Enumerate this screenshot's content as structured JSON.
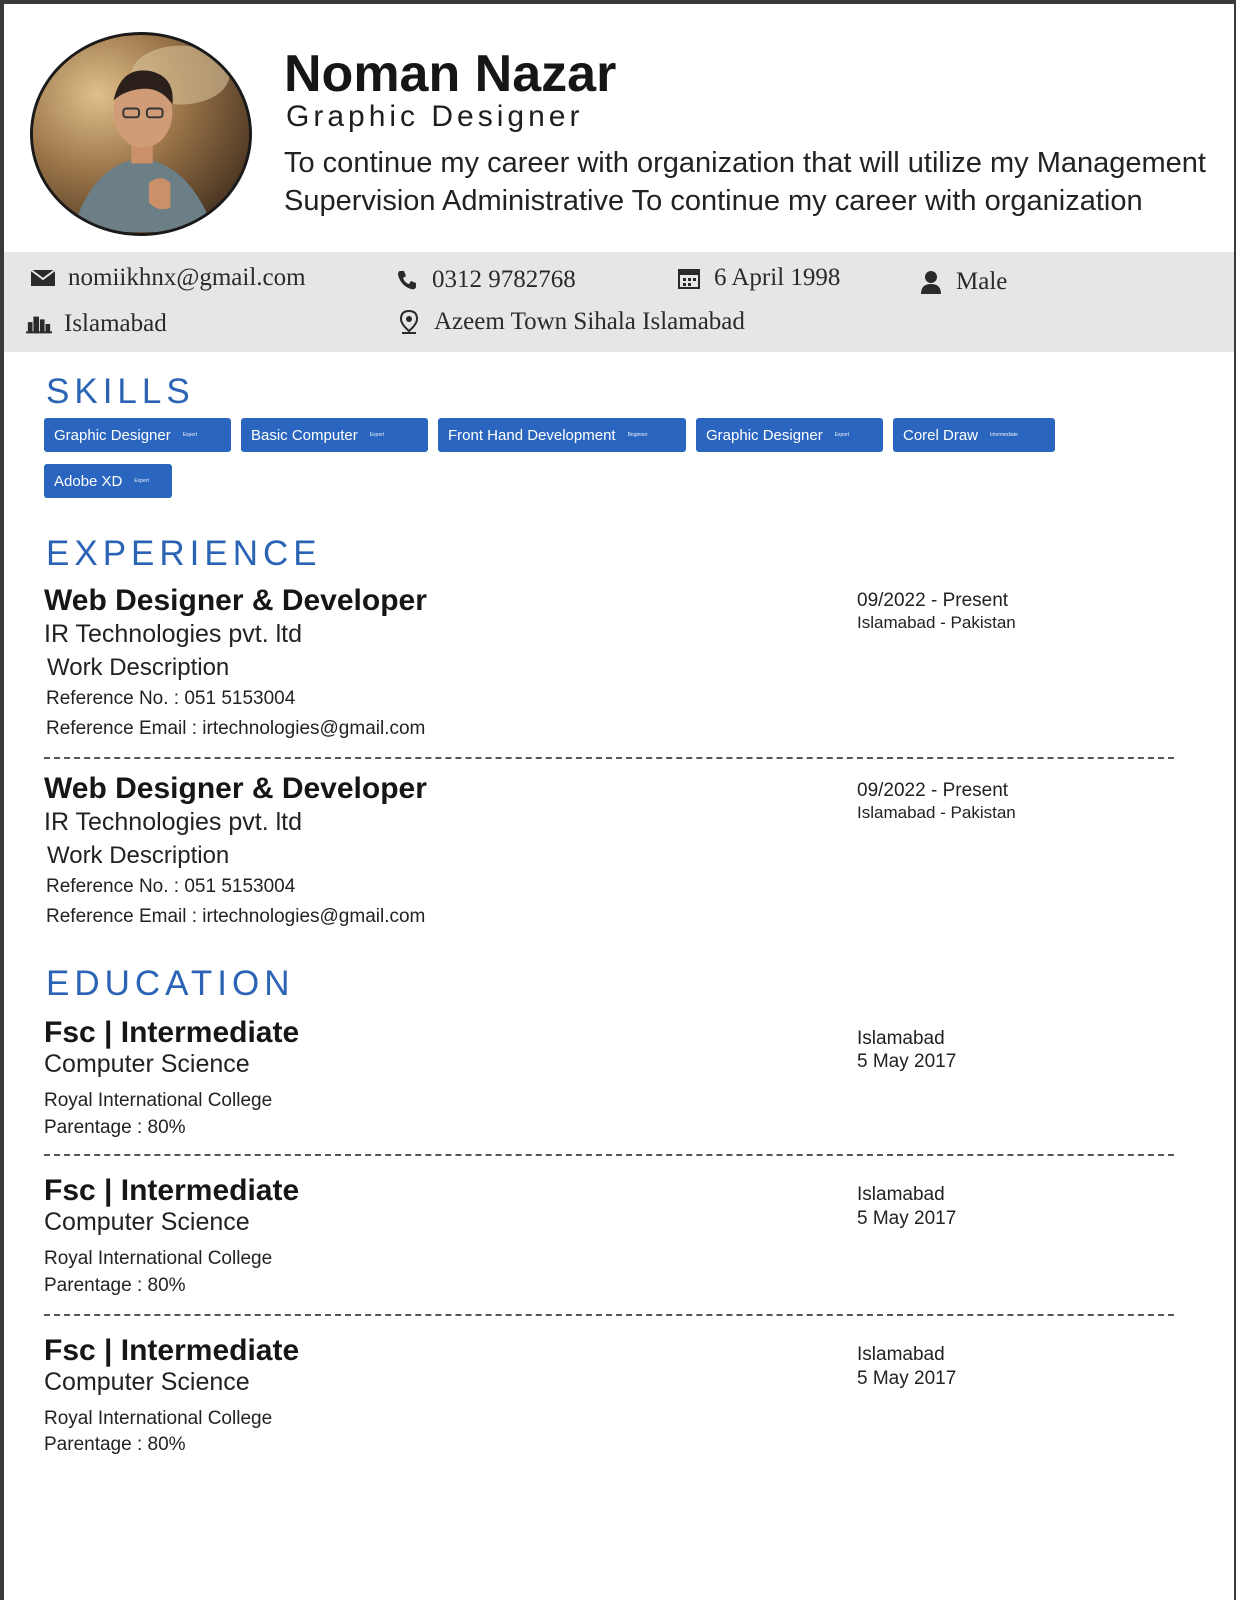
{
  "header": {
    "name": "Noman Nazar",
    "role": "Graphic Designer",
    "summary": "To continue my career with organization that will utilize my Management Supervision Administrative To continue my career with organization"
  },
  "contact": {
    "email": "nomiikhnx@gmail.com",
    "phone": "0312 9782768",
    "dob": "6 April 1998",
    "gender": "Male",
    "city": "Islamabad",
    "address": "Azeem Town Sihala Islamabad"
  },
  "skills": {
    "title": "SKILLS",
    "items": [
      {
        "label": "Graphic Designer",
        "level": "Expert"
      },
      {
        "label": "Basic Computer",
        "level": "Expert"
      },
      {
        "label": "Front Hand Development",
        "level": "Beginner"
      },
      {
        "label": "Graphic Designer",
        "level": "Expert"
      },
      {
        "label": "Corel Draw",
        "level": "Intermediate"
      },
      {
        "label": "Adobe XD",
        "level": "Expert"
      }
    ]
  },
  "experience": {
    "title": "EXPERIENCE",
    "items": [
      {
        "title": "Web Designer & Developer",
        "company": "IR Technologies pvt. ltd",
        "description": "Work Description",
        "ref_no": "Reference No. : 051 5153004",
        "ref_email": "Reference Email : irtechnologies@gmail.com",
        "period": "09/2022 - Present",
        "location": "Islamabad - Pakistan"
      },
      {
        "title": "Web Designer & Developer",
        "company": "IR Technologies pvt. ltd",
        "description": "Work Description",
        "ref_no": "Reference No. : 051 5153004",
        "ref_email": "Reference Email : irtechnologies@gmail.com",
        "period": "09/2022 - Present",
        "location": "Islamabad - Pakistan"
      }
    ]
  },
  "education": {
    "title": "EDUCATION",
    "items": [
      {
        "title": "Fsc | Intermediate",
        "field": "Computer Science",
        "institute": "Royal International College",
        "grade": "Parentage : 80%",
        "city": "Islamabad",
        "date": "5 May 2017"
      },
      {
        "title": "Fsc | Intermediate",
        "field": "Computer Science",
        "institute": "Royal International College",
        "grade": "Parentage : 80%",
        "city": "Islamabad",
        "date": "5 May 2017"
      },
      {
        "title": "Fsc | Intermediate",
        "field": "Computer Science",
        "institute": "Royal International College",
        "grade": "Parentage : 80%",
        "city": "Islamabad",
        "date": "5 May 2017"
      }
    ]
  },
  "icons": {
    "email": "envelope-icon",
    "phone": "phone-icon",
    "dob": "calendar-icon",
    "gender": "user-icon",
    "city": "buildings-icon",
    "address": "map-pin-icon"
  },
  "colors": {
    "accent": "#2c64b5",
    "chip": "#2a66bf",
    "contact_bg": "#e6e6e6"
  }
}
